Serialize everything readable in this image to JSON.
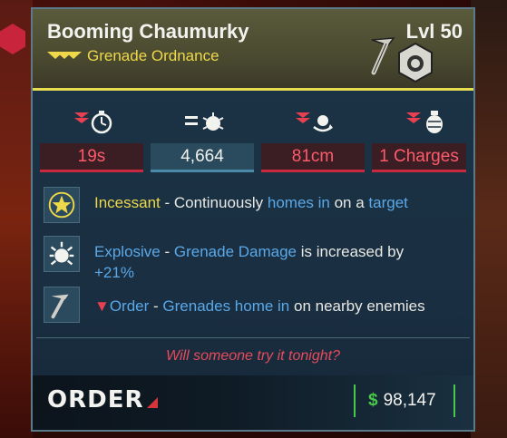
{
  "item": {
    "name": "Booming Chaumurky",
    "level": "Lvl 50",
    "type": "Grenade Ordnance"
  },
  "stats": [
    {
      "value": "19s",
      "icon": "timer-icon",
      "modifier": "decreased"
    },
    {
      "value": "4,664",
      "icon": "damage-icon",
      "modifier": "neutral"
    },
    {
      "value": "81cm",
      "icon": "radius-icon",
      "modifier": "decreased"
    },
    {
      "value": "1 Charges",
      "icon": "charges-icon",
      "modifier": "decreased"
    }
  ],
  "perks": [
    {
      "name": "Incessant",
      "sep": " - ",
      "desc_a": "Continuously ",
      "desc_hl": "homes in",
      "desc_b": " on a ",
      "desc_hl2": "target"
    },
    {
      "name": "Explosive",
      "sep": " - ",
      "desc_hl": "Grenade Damage",
      "desc_b": " is increased by",
      "desc_hl2": "+21%"
    },
    {
      "name": "Order",
      "sep": " - ",
      "desc_hl": "Grenades home in",
      "desc_b": " on nearby enemies"
    }
  ],
  "flavor_text": "Will someone try it tonight?",
  "manufacturer": "ORDER",
  "price": {
    "symbol": "$",
    "value": "98,147"
  },
  "colors": {
    "rarity": "#eed84a",
    "negative": "#ff5a6a",
    "highlight": "#5aa8e8",
    "price": "#4ac84a"
  }
}
